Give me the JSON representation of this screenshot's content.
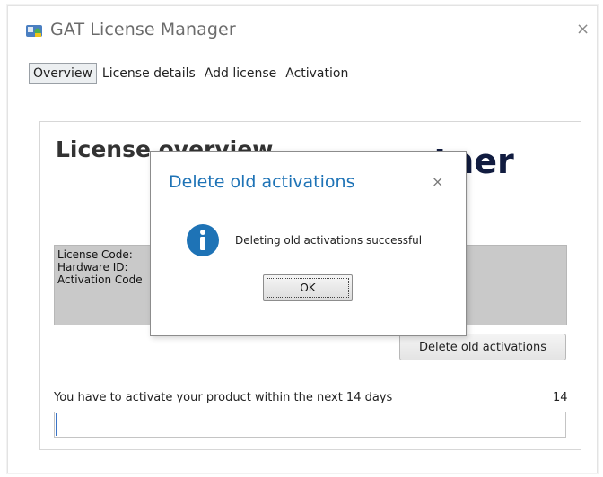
{
  "window": {
    "title": "GAT License Manager",
    "close_glyph": "×",
    "icon": "license-manager-app-icon"
  },
  "tabs": [
    {
      "label": "Overview",
      "active": true
    },
    {
      "label": "License details",
      "active": false
    },
    {
      "label": "Add license",
      "active": false
    },
    {
      "label": "Activation",
      "active": false
    }
  ],
  "overview": {
    "heading": "License overview",
    "brand_visible": "ntner",
    "code_labels": [
      "License Code:",
      "Hardware ID:",
      "Activation Code"
    ],
    "delete_button": "Delete old activations",
    "activation_notice": "You have to activate your product within the next 14 days",
    "days_remaining": "14",
    "progress_fraction": 0.004
  },
  "dialog": {
    "title": "Delete old activations",
    "close_glyph": "×",
    "icon": "info-icon",
    "message": "Deleting old activations successful",
    "ok_label": "OK"
  },
  "colors": {
    "dialog_title": "#1e73b6",
    "info_icon": "#1e73b6",
    "progress": "#3b74c6",
    "code_box": "#c9c9c9"
  }
}
